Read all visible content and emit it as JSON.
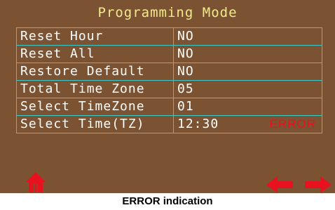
{
  "screen": {
    "title": "Programming Mode",
    "rows": [
      {
        "label": "Reset Hour",
        "value": "NO",
        "status": ""
      },
      {
        "label": "Reset All",
        "value": "NO",
        "status": ""
      },
      {
        "label": "Restore Default",
        "value": "NO",
        "status": ""
      },
      {
        "label": "Total Time Zone",
        "value": "05",
        "status": ""
      },
      {
        "label": "Select TimeZone",
        "value": "01",
        "status": ""
      },
      {
        "label": "Select Time(TZ)",
        "value": "12:30",
        "status": "ERROR"
      }
    ],
    "icons": {
      "home": "home-icon",
      "left": "left-arrow-icon",
      "right": "right-arrow-icon"
    },
    "colors": {
      "background": "#7b5232",
      "title": "#f3ea8d",
      "grid": "#3ec7c7",
      "error": "#e8121e"
    }
  },
  "caption": "ERROR indication"
}
